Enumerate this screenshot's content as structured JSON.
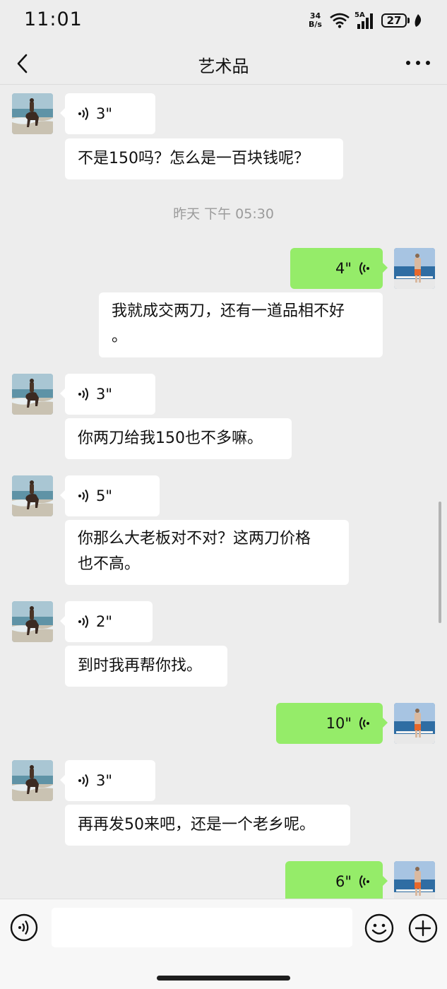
{
  "status_bar": {
    "time": "11:01",
    "net_speed_value": "34",
    "net_speed_unit": "B/s",
    "signal_label": "5A",
    "battery": "27"
  },
  "header": {
    "title": "艺术品",
    "back_icon": "chevron-left-icon",
    "more_icon": "ellipsis-icon"
  },
  "messages": [
    {
      "side": "in",
      "type": "voice",
      "duration": "3\""
    },
    {
      "side": "in",
      "type": "text",
      "text": "不是150吗？怎么是一百块钱呢？"
    },
    {
      "type": "timestamp",
      "text": "昨天 下午 05:30"
    },
    {
      "side": "out",
      "type": "voice",
      "duration": "4\""
    },
    {
      "side": "out",
      "type": "text",
      "line1": "我就成交两刀，还有一道品相不好",
      "line2": "。"
    },
    {
      "side": "in",
      "type": "voice",
      "duration": "3\""
    },
    {
      "side": "in",
      "type": "text",
      "text": "你两刀给我150也不多嘛。"
    },
    {
      "side": "in",
      "type": "voice",
      "duration": "5\""
    },
    {
      "side": "in",
      "type": "text",
      "line1": "你那么大老板对不对？这两刀价格",
      "line2": "也不高。"
    },
    {
      "side": "in",
      "type": "voice",
      "duration": "2\""
    },
    {
      "side": "in",
      "type": "text",
      "text": "到时我再帮你找。"
    },
    {
      "side": "out",
      "type": "voice",
      "duration": "10\""
    },
    {
      "side": "in",
      "type": "voice",
      "duration": "3\""
    },
    {
      "side": "in",
      "type": "text",
      "text": "再再发50来吧，还是一个老乡呢。"
    },
    {
      "side": "out",
      "type": "voice",
      "duration": "6\""
    }
  ],
  "input_bar": {
    "voice_icon": "voice-mode-icon",
    "placeholder": "",
    "emoji_icon": "emoji-icon",
    "plus_icon": "plus-icon"
  },
  "colors": {
    "background": "#ededed",
    "outgoing_bubble": "#95ec69",
    "incoming_bubble": "#ffffff",
    "timestamp": "#9b9b9b"
  }
}
